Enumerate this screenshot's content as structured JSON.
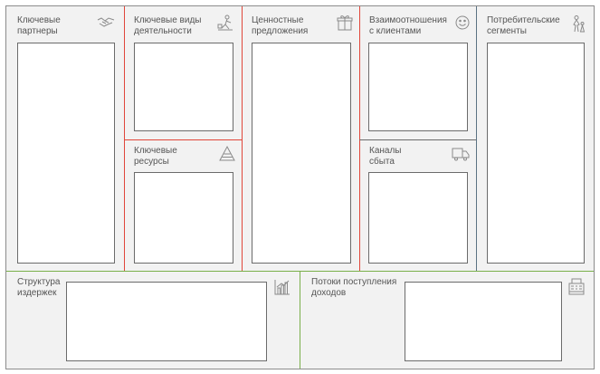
{
  "colors": {
    "background": "#f2f2f2",
    "border": "#8c8c8c",
    "red_divider": "#e0463a",
    "blue_divider": "#5b7283",
    "green_divider": "#7ab04a",
    "box_border": "#6b6b6b"
  },
  "blocks": {
    "key_partners": {
      "label": "Ключевые\nпартнеры",
      "icon": "handshake-icon"
    },
    "key_activities": {
      "label": "Ключевые виды\nдеятельности",
      "icon": "worker-icon"
    },
    "key_resources": {
      "label": "Ключевые\nресурсы",
      "icon": "pyramid-icon"
    },
    "value_propositions": {
      "label": "Ценностные\nпредложения",
      "icon": "gift-icon"
    },
    "customer_relationships": {
      "label": "Взаимоотношения\nс клиентами",
      "icon": "smiley-icon"
    },
    "channels": {
      "label": "Каналы\nсбыта",
      "icon": "truck-icon"
    },
    "customer_segments": {
      "label": "Потребительские\nсегменты",
      "icon": "people-icon"
    },
    "cost_structure": {
      "label": "Структура\nиздержек",
      "icon": "bar-chart-icon"
    },
    "revenue_streams": {
      "label": "Потоки поступления\nдоходов",
      "icon": "cash-register-icon"
    }
  }
}
